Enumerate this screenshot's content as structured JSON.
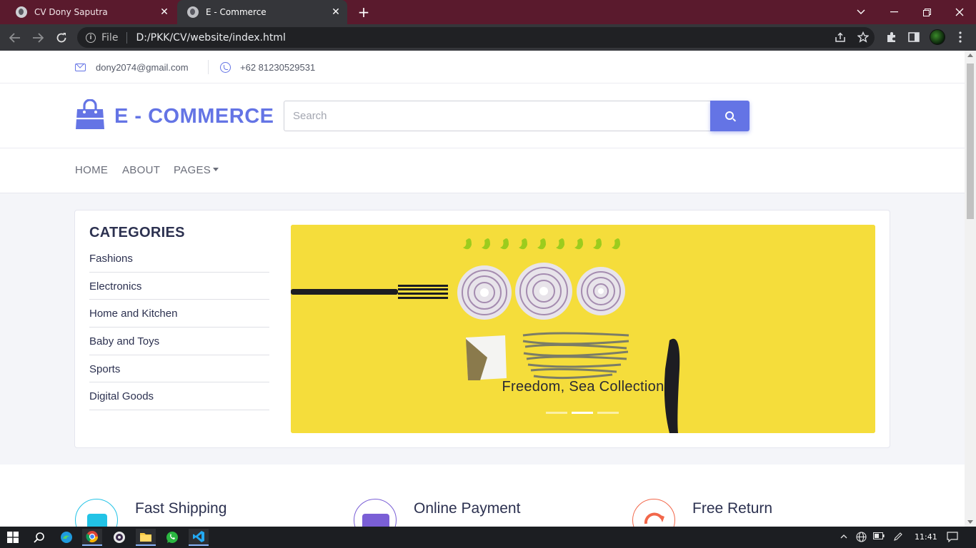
{
  "browser": {
    "tabs": [
      {
        "title": "CV Dony Saputra",
        "active": false
      },
      {
        "title": "E - Commerce",
        "active": true
      }
    ],
    "url_scheme": "File",
    "url": "D:/PKK/CV/website/index.html",
    "new_tab_icon": "+",
    "close_icon": "✕"
  },
  "topinfo": {
    "email": "dony2074@gmail.com",
    "phone": "+62 81230529531"
  },
  "header": {
    "logo_text": "E - COMMERCE",
    "search_placeholder": "Search",
    "accent": "#6474e5"
  },
  "nav": {
    "home": "HOME",
    "about": "ABOUT",
    "pages": "PAGES"
  },
  "categories": {
    "title": "CATEGORIES",
    "items": [
      "Fashions",
      "Electronics",
      "Home and Kitchen",
      "Baby and Toys",
      "Sports",
      "Digital Goods"
    ]
  },
  "carousel": {
    "caption": "Freedom, Sea Collection",
    "slide_count": 3,
    "active_index": 1,
    "background": "#f5dd3b"
  },
  "features": [
    {
      "title": "Fast Shipping",
      "icon": "truck-icon",
      "color": "#22c3e6"
    },
    {
      "title": "Online Payment",
      "icon": "credit-card-icon",
      "color": "#7a5fd6"
    },
    {
      "title": "Free Return",
      "icon": "refresh-icon",
      "color": "#f2674a"
    }
  ],
  "taskbar": {
    "time": "11:41"
  }
}
